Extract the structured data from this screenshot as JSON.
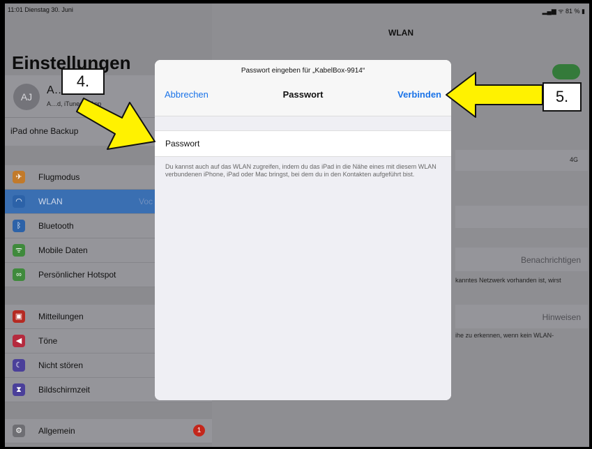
{
  "status_bar": {
    "time_date": "11:01  Dienstag 30. Juni",
    "battery": "81 %"
  },
  "sidebar": {
    "title": "Einstellungen",
    "profile": {
      "initials": "AJ",
      "name": "A…annsen",
      "subtitle": "A…d, iTunes & App"
    },
    "backup_label": "iPad ohne Backup",
    "group1": [
      {
        "label": "Flugmodus",
        "icon": "airplane-icon",
        "color": "#c27a2a"
      },
      {
        "label": "WLAN",
        "icon": "wifi-icon",
        "color": "#2c62a8",
        "value": "Voc"
      },
      {
        "label": "Bluetooth",
        "icon": "bluetooth-icon",
        "color": "#2c62a8"
      },
      {
        "label": "Mobile Daten",
        "icon": "antenna-icon",
        "color": "#3f8a3c"
      },
      {
        "label": "Persönlicher Hotspot",
        "icon": "hotspot-icon",
        "color": "#3f8a3c"
      }
    ],
    "group2": [
      {
        "label": "Mitteilungen",
        "icon": "notifications-icon",
        "color": "#b52a22"
      },
      {
        "label": "Töne",
        "icon": "sound-icon",
        "color": "#b52a3e"
      },
      {
        "label": "Nicht stören",
        "icon": "moon-icon",
        "color": "#4a3f9a"
      },
      {
        "label": "Bildschirmzeit",
        "icon": "hourglass-icon",
        "color": "#4a3f9a"
      }
    ],
    "group3": [
      {
        "label": "Allgemein",
        "icon": "gear-icon",
        "color": "#6e6e73",
        "badge": "1"
      }
    ]
  },
  "detail": {
    "title": "WLAN",
    "cellular": "4G",
    "notify_label": "Benachrichtigen",
    "notify_hint": "kanntes Netzwerk vorhanden ist, wirst",
    "hint_label": "Hinweisen",
    "hint_text": "ihe zu erkennen, wenn kein WLAN-"
  },
  "modal": {
    "prompt": "Passwort eingeben für „KabelBox-9914“",
    "title": "Passwort",
    "cancel_label": "Abbrechen",
    "connect_label": "Verbinden",
    "password_placeholder": "Passwort",
    "hint": "Du kannst auch auf das WLAN zugreifen, indem du das iPad in die Nähe eines mit diesem WLAN verbundenen iPhone, iPad oder Mac bringst, bei dem du in den Kontakten aufgeführt bist."
  },
  "annotations": {
    "step4": "4.",
    "step5": "5.",
    "arrow_color": "#fff200"
  }
}
